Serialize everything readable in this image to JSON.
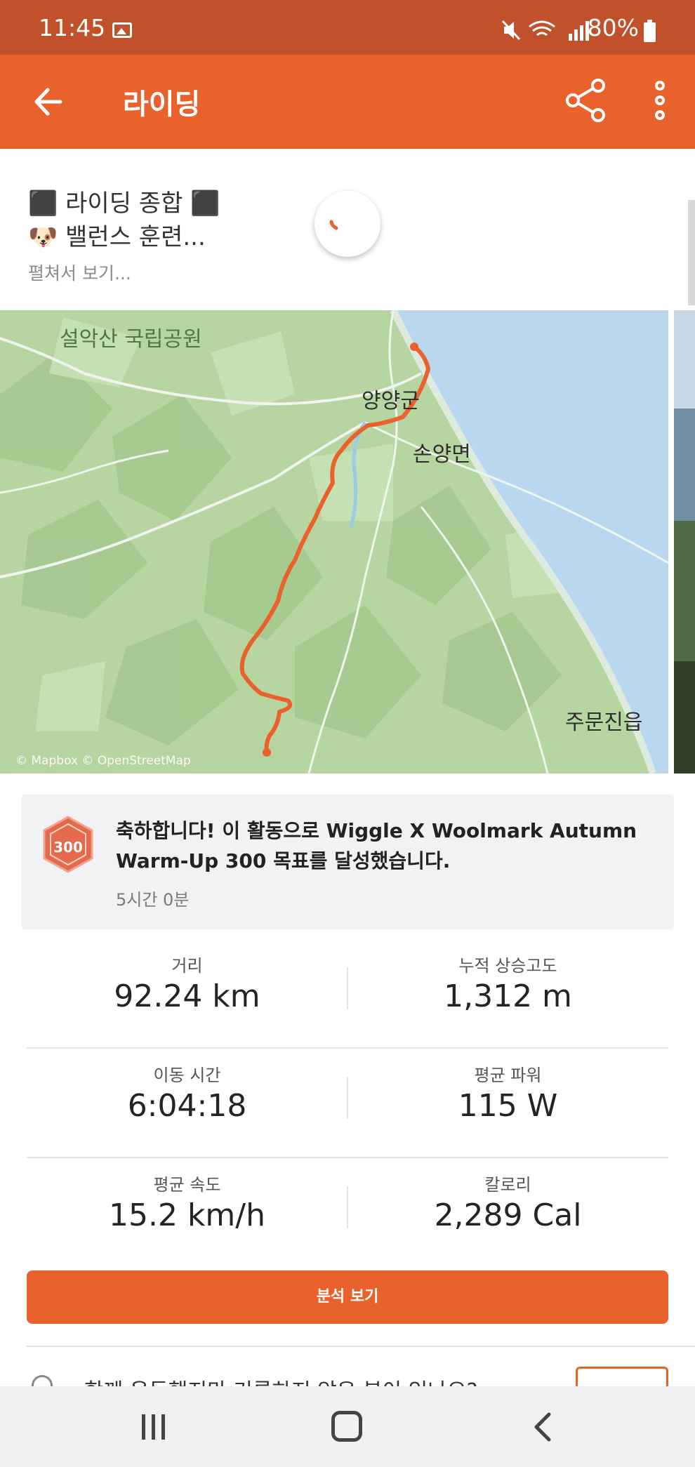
{
  "status_bar": {
    "time": "11:45",
    "battery": "80%",
    "icons": [
      "image-icon",
      "mute-icon",
      "wifi-icon",
      "signal-icon",
      "battery-icon"
    ]
  },
  "app_bar": {
    "title": "라이딩",
    "color": "#e9612b"
  },
  "activity": {
    "title_line1": "⬛ 라이딩 종합 ⬛",
    "title_line2": "🐶 밸런스 훈련...",
    "expand": "펼쳐서 보기..."
  },
  "map": {
    "labels": {
      "park": "설악산 국립공원",
      "yangyang": "양양군",
      "sonyang": "손양면",
      "jumunjin": "주문진읍"
    },
    "attribution": "© Mapbox © OpenStreetMap",
    "route_color": "#e9612b"
  },
  "achievement": {
    "text": "축하합니다! 이 활동으로 Wiggle X Woolmark Autumn Warm-Up 300 목표를 달성했습니다.",
    "time": "5시간 0분",
    "badge_number": "300"
  },
  "stats": {
    "distance": {
      "label": "거리",
      "value": "92.24 km"
    },
    "elevation": {
      "label": "누적 상승고도",
      "value": "1,312 m"
    },
    "moving_time": {
      "label": "이동 시간",
      "value": "6:04:18"
    },
    "avg_power": {
      "label": "평균 파워",
      "value": "115 W"
    },
    "avg_speed": {
      "label": "평균 속도",
      "value": "15.2 km/h"
    },
    "calories": {
      "label": "칼로리",
      "value": "2,289 Cal"
    }
  },
  "analysis_button": "분석 보기",
  "partial_row_text": "함께 운동했지만 기록하지 않은 분이 있나요?"
}
